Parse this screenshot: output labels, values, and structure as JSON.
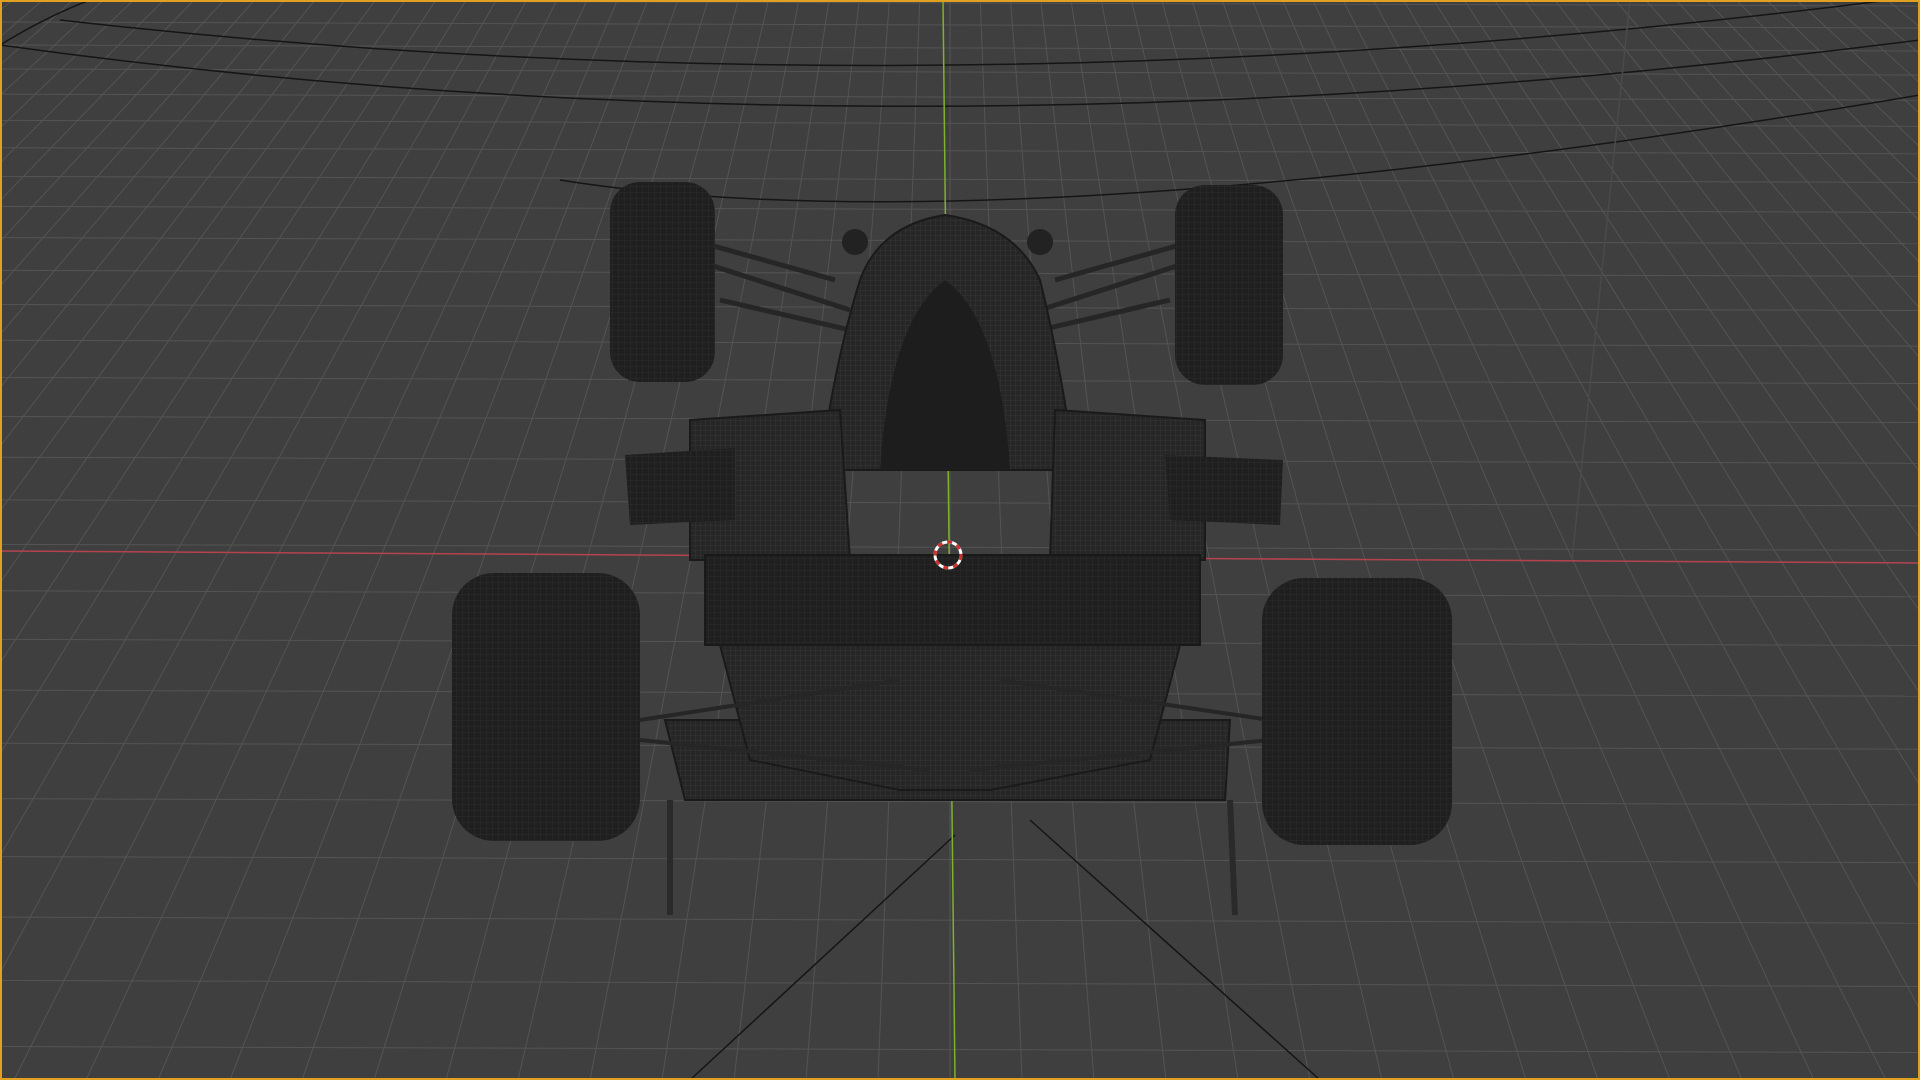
{
  "viewport": {
    "background_color": "#3f3f3f",
    "grid_color": "#555555",
    "active_border_color": "#e0a020",
    "axis_x_color": "#b5434f",
    "axis_y_color": "#7fb12c",
    "model_color": "#1f1f1f",
    "wire_color": "#2b2b2b",
    "cursor_colors": [
      "#ffffff",
      "#d0312d"
    ],
    "objects": {
      "model": "formula-race-car-wireframe",
      "camera": "camera-frame-lines",
      "cursor": "3d-cursor-icon"
    }
  }
}
